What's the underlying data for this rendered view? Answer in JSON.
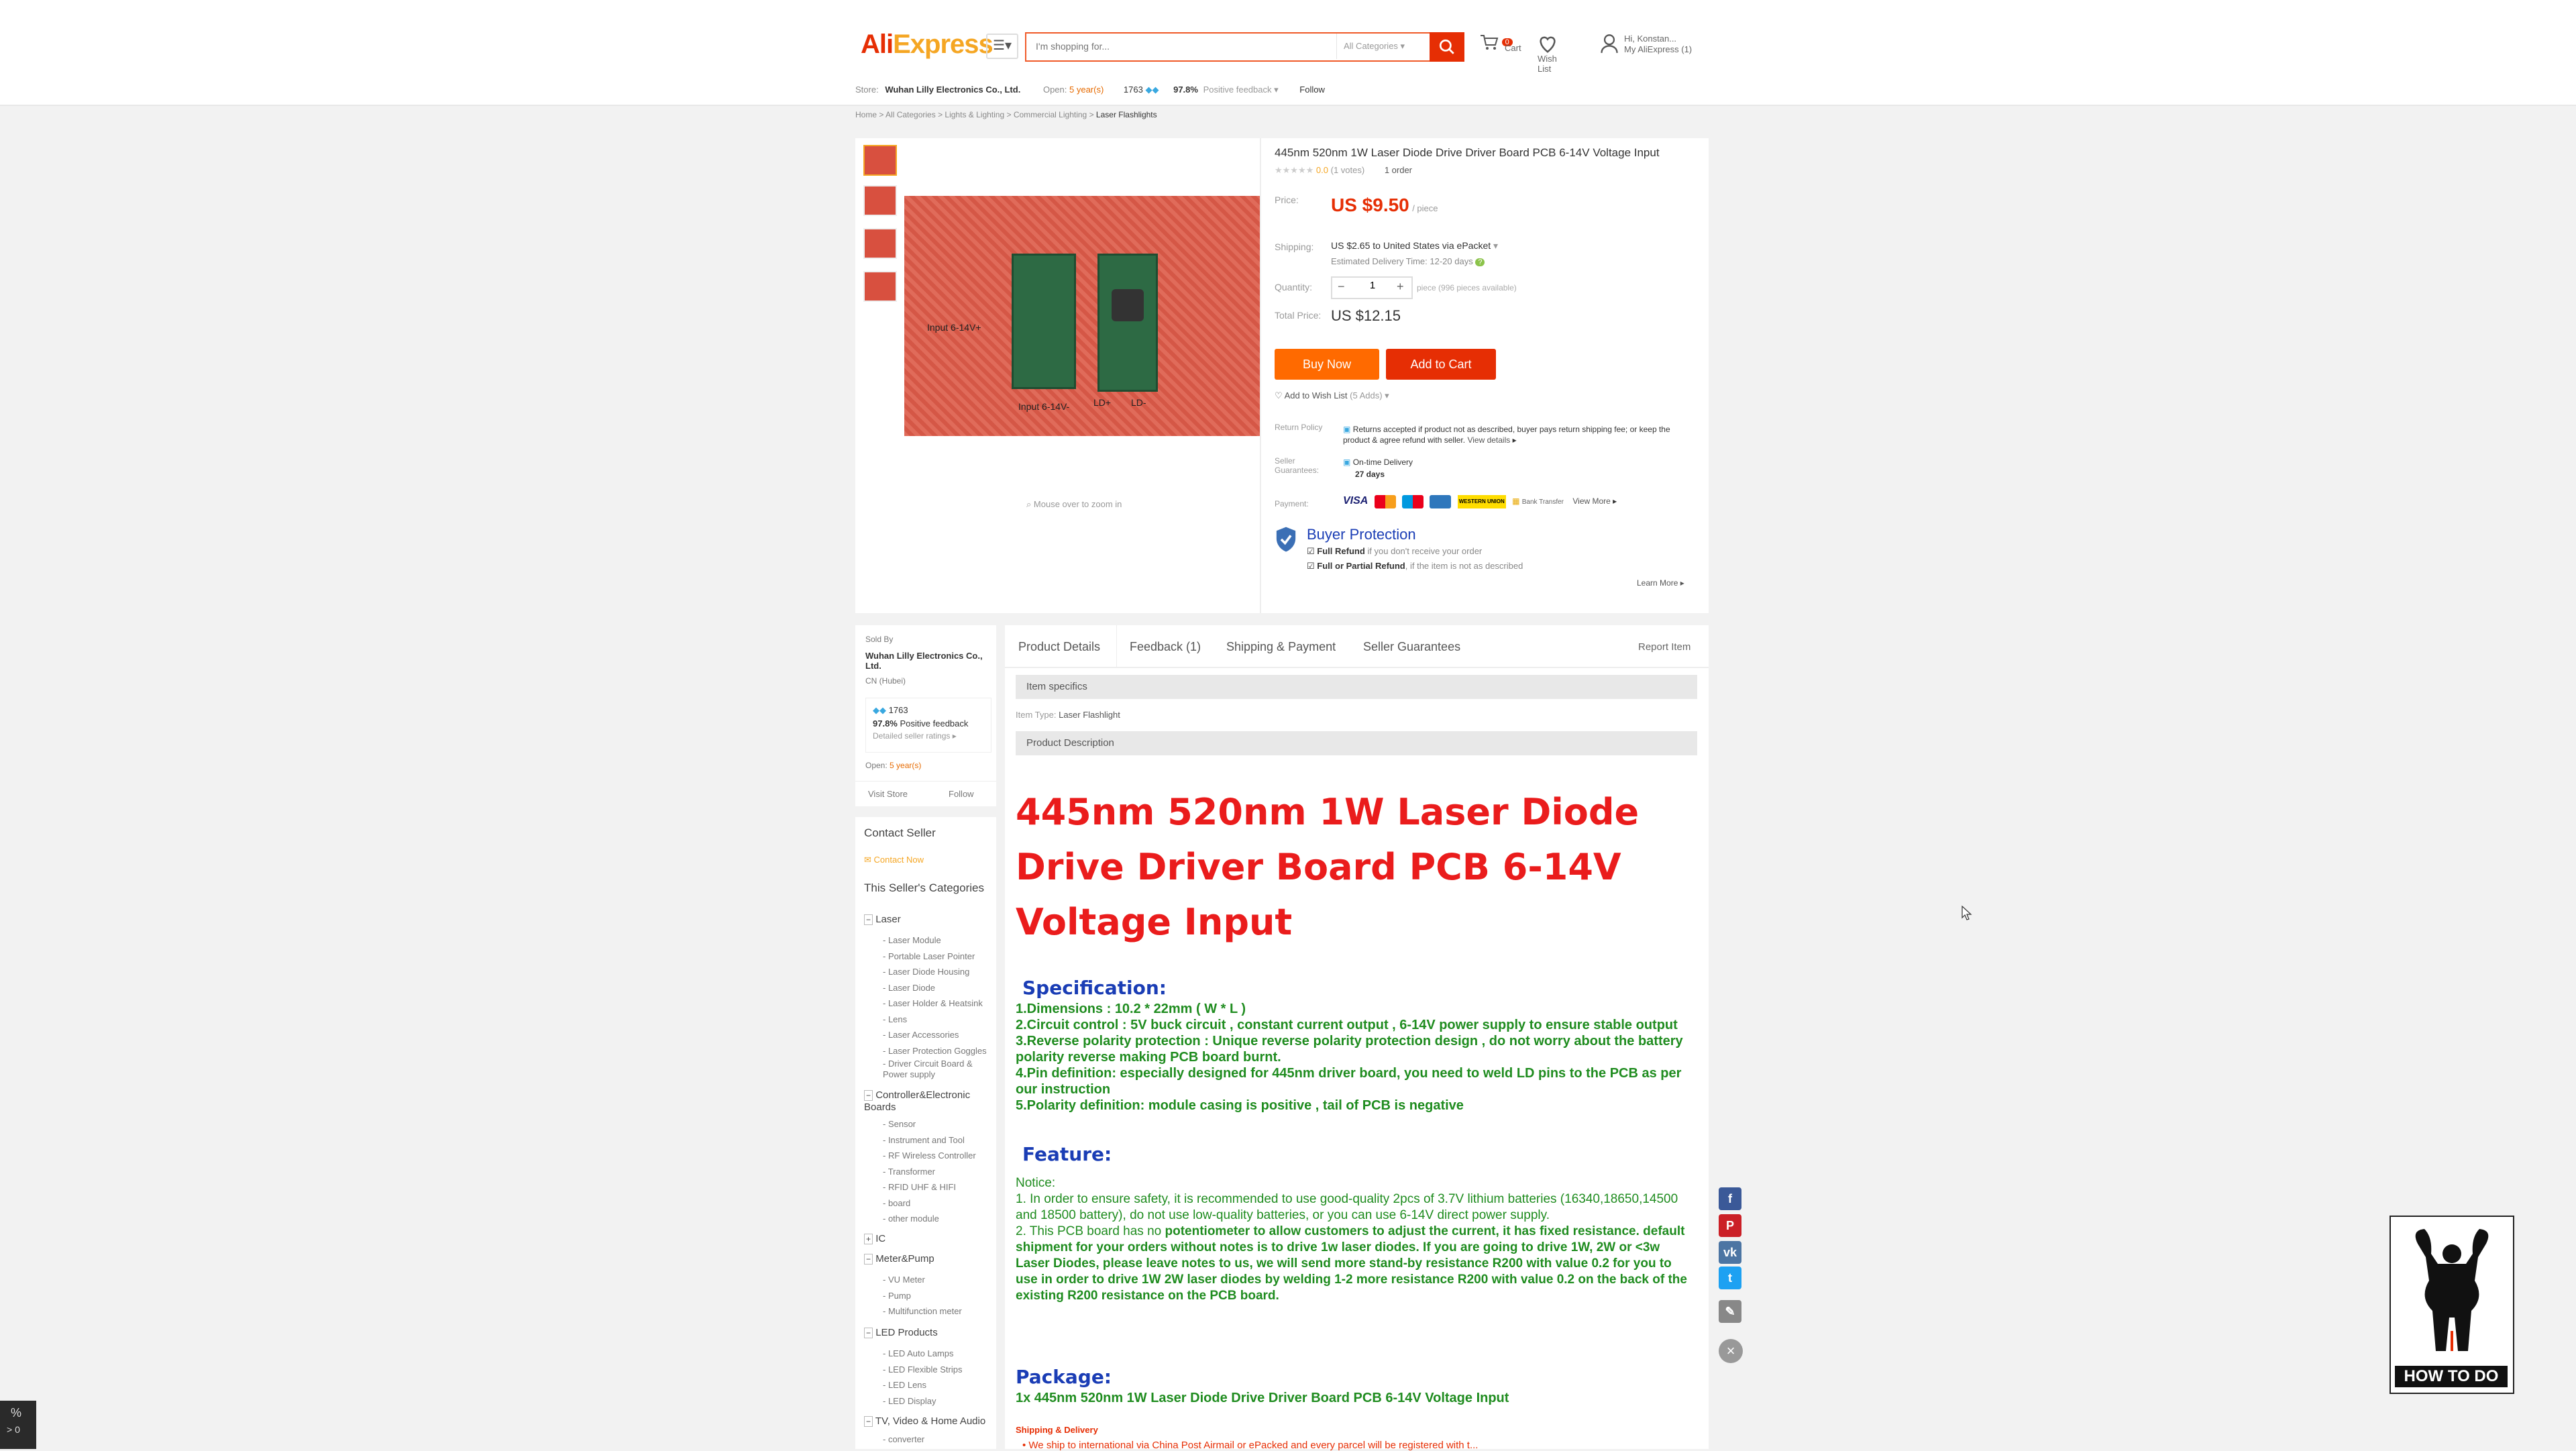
{
  "header": {
    "logo_ali": "Ali",
    "logo_express": "Express",
    "search_placeholder": "I'm shopping for...",
    "search_category": "All Categories",
    "cart_count": "0",
    "cart_label": "Cart",
    "wish_label": "Wish List",
    "user_greeting": "Hi, Konstan...",
    "my_aliexpress": "My AliExpress (1)"
  },
  "store": {
    "label": "Store:",
    "name": "Wuhan Lilly Electronics Co., Ltd.",
    "open_label": "Open:",
    "open_value": "5 year(s)",
    "score": "1763",
    "positive_pct": "97.8%",
    "positive_label": "Positive feedback",
    "follow": "Follow"
  },
  "breadcrumb": [
    "Home",
    "All Categories",
    "Lights & Lighting",
    "Commercial Lighting",
    "Laser Flashlights"
  ],
  "product": {
    "title": "445nm 520nm 1W Laser Diode Drive Driver Board PCB 6-14V Voltage Input",
    "rating": "0.0",
    "votes": "(1 votes)",
    "orders": "1 order",
    "price_label": "Price:",
    "price": "US $9.50",
    "price_unit": "/ piece",
    "shipping_label": "Shipping:",
    "shipping_value": "US $2.65 to United States via ePacket",
    "delivery": "Estimated Delivery Time: 12-20 days",
    "quantity_label": "Quantity:",
    "quantity": "1",
    "quantity_note": "piece (996 pieces available)",
    "total_label": "Total Price:",
    "total": "US $12.15",
    "buy_now": "Buy Now",
    "add_to_cart": "Add to Cart",
    "wishlist": "Add to Wish List",
    "wishlist_count": "(5 Adds)",
    "zoom_hint": "Mouse over to zoom in",
    "img_label_1": "Input 6-14V+",
    "img_label_2": "Input 6-14V-",
    "img_label_3": "LD+",
    "img_label_4": "LD-"
  },
  "policy": {
    "return_label": "Return Policy",
    "return_text": "Returns accepted if product not as described, buyer pays return shipping fee; or keep the product & agree refund with seller.",
    "view_details": "View details",
    "guarantee_label": "Seller Guarantees:",
    "ontime": "On-time Delivery",
    "days": "27 days",
    "payment_label": "Payment:",
    "pay_visa": "VISA",
    "pay_wu": "WESTERN UNION",
    "bank": "Bank Transfer",
    "view_more": "View More",
    "buyer_protection": "Buyer Protection",
    "full_refund": "Full Refund",
    "full_refund_note": "if you don't receive your order",
    "partial_refund": "Full or Partial Refund",
    "partial_refund_note": ", if the item is not as described",
    "learn_more": "Learn More"
  },
  "sidebar": {
    "sold_by": "Sold By",
    "seller": "Wuhan Lilly Electronics Co., Ltd.",
    "location": "CN (Hubei)",
    "score": "1763",
    "positive": "97.8%",
    "positive_label": "Positive feedback",
    "detailed": "Detailed seller ratings",
    "open_label": "Open:",
    "open_value": "5 year(s)",
    "visit_store": "Visit Store",
    "follow": "Follow",
    "contact_seller": "Contact Seller",
    "contact_now": "Contact Now",
    "categories_title": "This Seller's Categories",
    "cat_laser": "Laser",
    "laser_items": [
      "- Laser Module",
      "- Portable Laser Pointer",
      "- Laser Diode Housing",
      "- Laser Diode",
      "- Laser Holder & Heatsink",
      "- Lens",
      "- Laser Accessories",
      "- Laser Protection Goggles",
      "- Driver Circuit Board &",
      "Power supply"
    ],
    "cat_controller": "Controller&Electronic Boards",
    "controller_items": [
      "- Sensor",
      "- Instrument and Tool",
      "- RF Wireless Controller",
      "- Transformer",
      "- RFID UHF & HIFI",
      "- board",
      "- other module"
    ],
    "cat_ic": "IC",
    "cat_meter": "Meter&Pump",
    "meter_items": [
      "- VU Meter",
      "- Pump",
      "- Multifunction meter"
    ],
    "cat_led": "LED Products",
    "led_items": [
      "- LED Auto Lamps",
      "- LED Flexible Strips",
      "- LED Lens",
      "- LED Display"
    ],
    "cat_tv": "TV, Video & Home Audio",
    "tv_items": [
      "- converter"
    ]
  },
  "tabs": [
    "Product Details",
    "Feedback (1)",
    "Shipping & Payment",
    "Seller Guarantees"
  ],
  "report": "Report Item",
  "details": {
    "item_specifics": "Item specifics",
    "item_type_label": "Item Type:",
    "item_type": "Laser Flashlight",
    "product_description": "Product Description",
    "big_title": "445nm 520nm 1W Laser Diode Drive Driver Board PCB 6-14V Voltage Input",
    "spec_heading": "Specification:",
    "spec_lines": [
      "1.Dimensions : 10.2 * 22mm ( W * L )",
      "2.Circuit control : 5V buck circuit , constant current output , 6-14V power supply to ensure stable output",
      "3.Reverse polarity protection : Unique reverse polarity protection design , do not worry about the battery polarity reverse making PCB board burnt.",
      "4.Pin definition: especially designed for 445nm driver board, you need to weld LD pins to the PCB as per our instruction",
      "5.Polarity definition: module casing is positive , tail of PCB is negative"
    ],
    "feature_heading": "Feature:",
    "notice": "Notice:",
    "notice_1": "1. In order to ensure safety, it is recommended to use good-quality 2pcs of 3.7V lithium batteries (16340,18650,14500 and 18500 battery), do not use low-quality batteries, or you can use 6-14V direct power supply.",
    "notice_2a": "2. This PCB board has no ",
    "notice_2b": "potentiometer to allow customers to adjust the current, it has fixed resistance. default shipment for your orders without notes is to drive 1w laser diodes. If you are going to drive 1W, 2W or <3w Laser Diodes, please leave notes to us, we will send more stand-by resistance R200 with value 0.2 for you to use in order to drive 1W 2W laser diodes by welding 1-2 more  resistance R200 with value 0.2 on the back of the existing R200 resistance on the PCB board.",
    "package_heading": "Package:",
    "package_line": "1x 445nm 520nm  1W Laser Diode Drive Driver Board PCB 6-14V Voltage Input",
    "shipping_delivery": "Shipping & Delivery",
    "shipping_line": "We ship to international via China Post Airmail or ePacked and every parcel will be registered with t..."
  },
  "watermark": {
    "text": "HOW TO DO"
  },
  "corner": {
    "top": "%",
    "bottom": "> 0"
  },
  "colors": {
    "brand_red": "#e62e04",
    "brand_orange": "#f5a623",
    "desc_red": "#ea1c1c",
    "spec_blue": "#1a3db5",
    "spec_green": "#1f8c1f"
  }
}
